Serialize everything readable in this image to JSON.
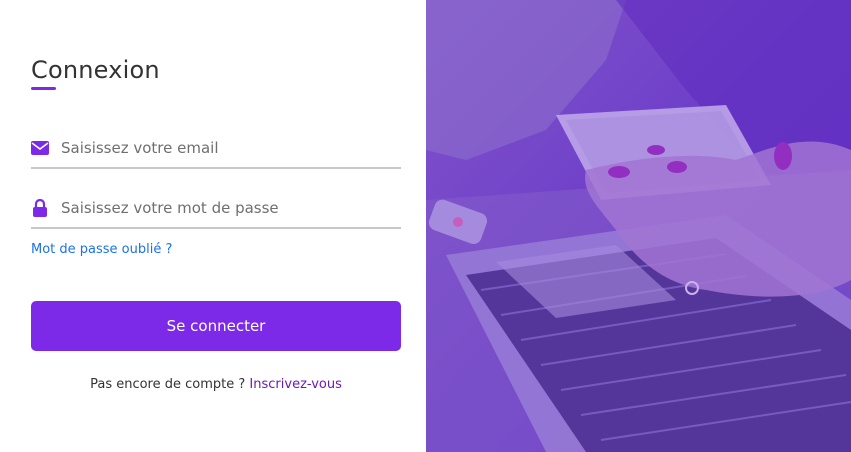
{
  "login": {
    "title": "Connexion",
    "email_placeholder": "Saisissez votre email",
    "password_placeholder": "Saisissez votre mot de passe",
    "forgot_password": "Mot de passe oublié ?",
    "submit_label": "Se connecter",
    "signup_prompt": "Pas encore de compte ?",
    "signup_link": "Inscrivez-vous"
  },
  "colors": {
    "accent": "#7d2ae8",
    "link_blue": "#1a73e8",
    "signup_link": "#6a1bb5",
    "overlay_purple": "#6f45c4"
  },
  "icons": {
    "email": "envelope-icon",
    "password": "lock-icon"
  },
  "image_panel": {
    "subject": "hand holding smartphone over laptop keyboard",
    "tint": "purple overlay"
  }
}
